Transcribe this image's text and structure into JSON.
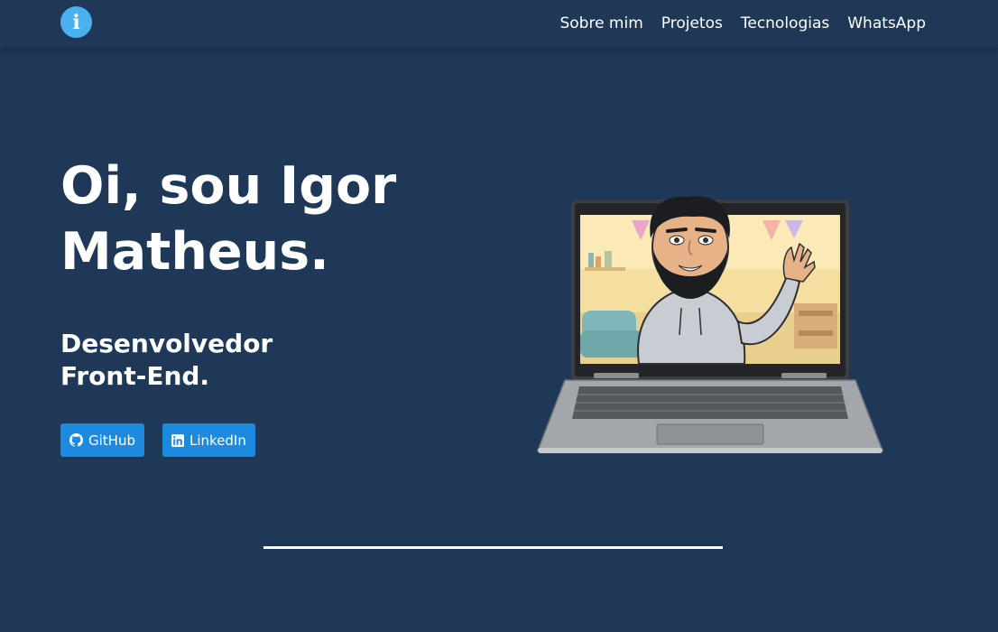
{
  "navbar": {
    "logo_letter": "i",
    "links": [
      {
        "label": "Sobre mim"
      },
      {
        "label": "Projetos"
      },
      {
        "label": "Tecnologias"
      },
      {
        "label": "WhatsApp"
      }
    ]
  },
  "hero": {
    "title": "Oi, sou Igor Matheus.",
    "subtitle": "Desenvolvedor Front-End.",
    "buttons": [
      {
        "label": "GitHub",
        "icon": "github-icon"
      },
      {
        "label": "LinkedIn",
        "icon": "linkedin-icon"
      }
    ]
  },
  "colors": {
    "background": "#1f3858",
    "accent": "#4bb0ee",
    "button": "#1c8ade",
    "text": "#ffffff"
  }
}
